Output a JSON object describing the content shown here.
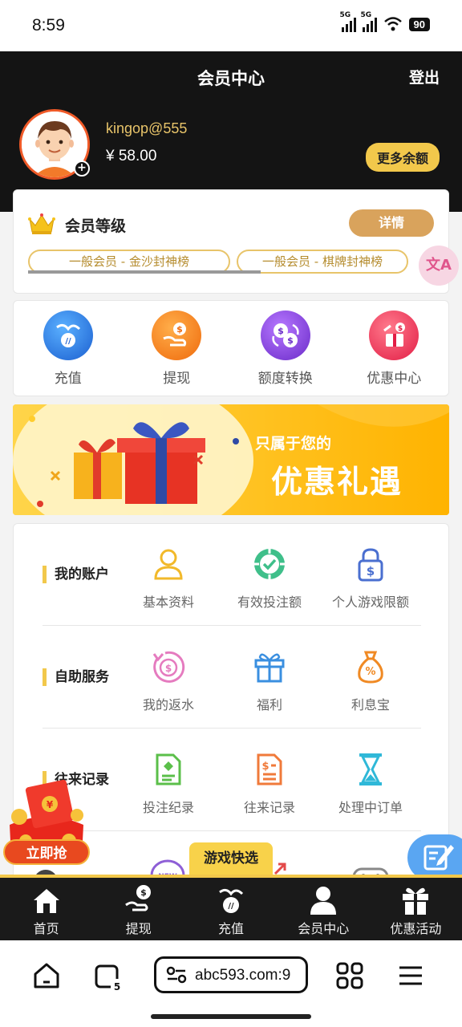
{
  "status_bar": {
    "time": "8:59",
    "sim1": "5G",
    "sim2": "5G",
    "battery": "90"
  },
  "header": {
    "title": "会员中心",
    "logout_label": "登出",
    "username": "kingop@555",
    "balance": "¥ 58.00",
    "more_balance_label": "更多余额"
  },
  "level": {
    "title": "会员等级",
    "detail_label": "详情",
    "tags": [
      "一般会员 - 金沙封神榜",
      "一般会员 - 棋牌封神榜"
    ]
  },
  "translate_fab_label": "文A",
  "quick_actions": [
    {
      "label": "充值",
      "icon": "deposit-icon",
      "color": "#2f7ee8"
    },
    {
      "label": "提现",
      "icon": "withdraw-icon",
      "color": "#f07a1c"
    },
    {
      "label": "额度转换",
      "icon": "transfer-icon",
      "color": "#8b4ad6"
    },
    {
      "label": "优惠中心",
      "icon": "promo-icon",
      "color": "#ef3c59"
    }
  ],
  "banner": {
    "subtitle": "只属于您的",
    "title": "优惠礼遇"
  },
  "menu": [
    {
      "category": "我的账户",
      "items": [
        {
          "label": "基本资料",
          "icon": "user-icon"
        },
        {
          "label": "有效投注额",
          "icon": "chip-check-icon"
        },
        {
          "label": "个人游戏限额",
          "icon": "lock-dollar-icon"
        }
      ]
    },
    {
      "category": "自助服务",
      "items": [
        {
          "label": "我的返水",
          "icon": "rebate-icon"
        },
        {
          "label": "福利",
          "icon": "gift-icon"
        },
        {
          "label": "利息宝",
          "icon": "money-bag-icon"
        }
      ]
    },
    {
      "category": "往来记录",
      "items": [
        {
          "label": "投注纪录",
          "icon": "bet-record-icon"
        },
        {
          "label": "往来记录",
          "icon": "transaction-record-icon"
        },
        {
          "label": "处理中订单",
          "icon": "hourglass-icon"
        }
      ]
    }
  ],
  "floating": {
    "grab_label": "立即抢",
    "close_label": "×",
    "game_quick_label": "游戏快选"
  },
  "bottom_nav": [
    {
      "label": "首页",
      "icon": "home-icon"
    },
    {
      "label": "提现",
      "icon": "withdraw-icon"
    },
    {
      "label": "充值",
      "icon": "deposit-icon"
    },
    {
      "label": "会员中心",
      "icon": "member-icon"
    },
    {
      "label": "优惠活动",
      "icon": "gift-icon"
    }
  ],
  "browser": {
    "url": "abc593.com:9",
    "tab_count": "5"
  },
  "colors": {
    "accent": "#f2c84b",
    "header_bg": "#141414",
    "gold_text": "#e8c46a"
  }
}
